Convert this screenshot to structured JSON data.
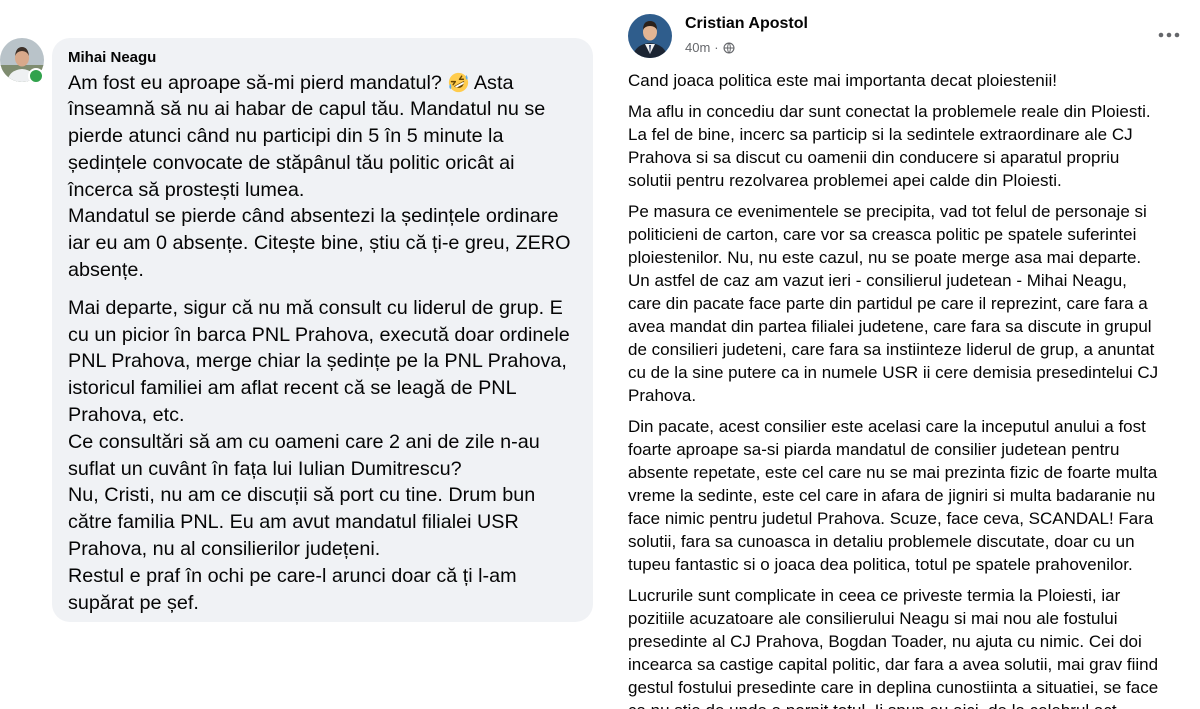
{
  "colors": {
    "text": "#050505",
    "secondary_text": "#65676b",
    "comment_bubble": "#f0f2f5",
    "online_status": "#31a24c",
    "page_background": "#ffffff"
  },
  "left_comment": {
    "author": "Mihai Neagu",
    "avatar_icon": "profile-photo",
    "opening_line": {
      "before_emoji": "Am fost eu aproape să-mi pierd mandatul?",
      "emoji_icon": "rolling-on-the-floor-laughing-emoji",
      "after_emoji": "Asta"
    },
    "paragraphs": [
      [
        "înseamnă să nu ai habar de capul tău. Mandatul nu se",
        "pierde atunci când nu participi din 5 în 5 minute la",
        "ședințele convocate de stăpânul tău politic oricât ai",
        "încerca să prostești lumea.",
        "Mandatul se pierde când absentezi la ședințele ordinare",
        "iar eu am 0 absențe. Citește bine, știu că ți-e greu, ZERO",
        "absențe."
      ],
      [
        "Mai departe, sigur că nu mă consult cu liderul de grup. E",
        "cu un picior în barca PNL Prahova, execută doar ordinele",
        "PNL Prahova, merge chiar la ședințe pe la PNL Prahova,",
        "istoricul familiei am aflat recent că se leagă de PNL",
        "Prahova, etc.",
        "Ce consultări să am cu oameni care 2 ani de zile n-au",
        "suflat un cuvânt în fața lui Iulian Dumitrescu?",
        "Nu, Cristi, nu am ce discuții să port cu tine. Drum bun",
        "către familia PNL. Eu am avut mandatul filialei USR",
        "Prahova, nu al consilierilor județeni.",
        "Restul e praf în ochi pe care-l arunci doar că ți l-am",
        "supărat pe șef."
      ]
    ]
  },
  "right_post": {
    "author": "Cristian Apostol",
    "avatar_icon": "profile-photo",
    "timestamp": "40m",
    "separator": "·",
    "privacy_icon": "globe-icon",
    "more_icon": "more-options-icon",
    "paragraphs": [
      [
        "Cand joaca politica este mai importanta decat ploiestenii!"
      ],
      [
        "Ma aflu in concediu dar sunt conectat la problemele reale din Ploiesti.",
        "La fel de bine, incerc sa particip si la sedintele extraordinare ale CJ",
        "Prahova si sa discut cu oamenii din conducere si aparatul propriu",
        "solutii pentru rezolvarea problemei apei calde din Ploiesti."
      ],
      [
        "Pe masura ce evenimentele se precipita, vad tot felul de personaje si",
        "politicieni de carton, care vor sa creasca politic pe spatele suferintei",
        "ploiestenilor. Nu, nu este cazul, nu se poate merge asa mai departe.",
        "Un astfel de caz am vazut ieri - consilierul judetean - Mihai Neagu,",
        "care din pacate face parte din partidul pe care il reprezint, care fara a",
        "avea mandat din partea filialei judetene, care fara sa discute in grupul",
        "de consilieri judeteni, care fara sa instiinteze liderul de grup, a anuntat",
        "cu de la sine putere ca in numele USR ii cere demisia presedintelui CJ",
        "Prahova."
      ],
      [
        "Din pacate, acest consilier este acelasi care la inceputul anului a fost",
        "foarte aproape sa-si piarda mandatul de consilier judetean pentru",
        "absente repetate, este cel care nu se mai prezinta fizic de foarte multa",
        "vreme la sedinte, este cel care in afara de jigniri si multa badaranie nu",
        "face nimic pentru judetul Prahova. Scuze, face ceva, SCANDAL! Fara",
        "solutii, fara sa cunoasca in detaliu problemele discutate, doar cu un",
        "tupeu fantastic si o joaca dea politica, totul pe spatele prahovenilor."
      ],
      [
        "Lucrurile sunt complicate in ceea ce priveste termia la Ploiesti, iar",
        "pozitiile acuzatoare ale consilierului Neagu si mai nou ale fostului",
        "presedinte al CJ Prahova, Bogdan Toader, nu ajuta cu nimic. Cei doi",
        "incearca sa castige capital politic, dar fara a avea solutii, mai grav fiind",
        "gestul fostului presedinte care in deplina cunostiinta a situatiei, se face",
        "ca nu stie de unde a pornit totul. Ii spun eu aici, de la celebrul act"
      ]
    ]
  }
}
